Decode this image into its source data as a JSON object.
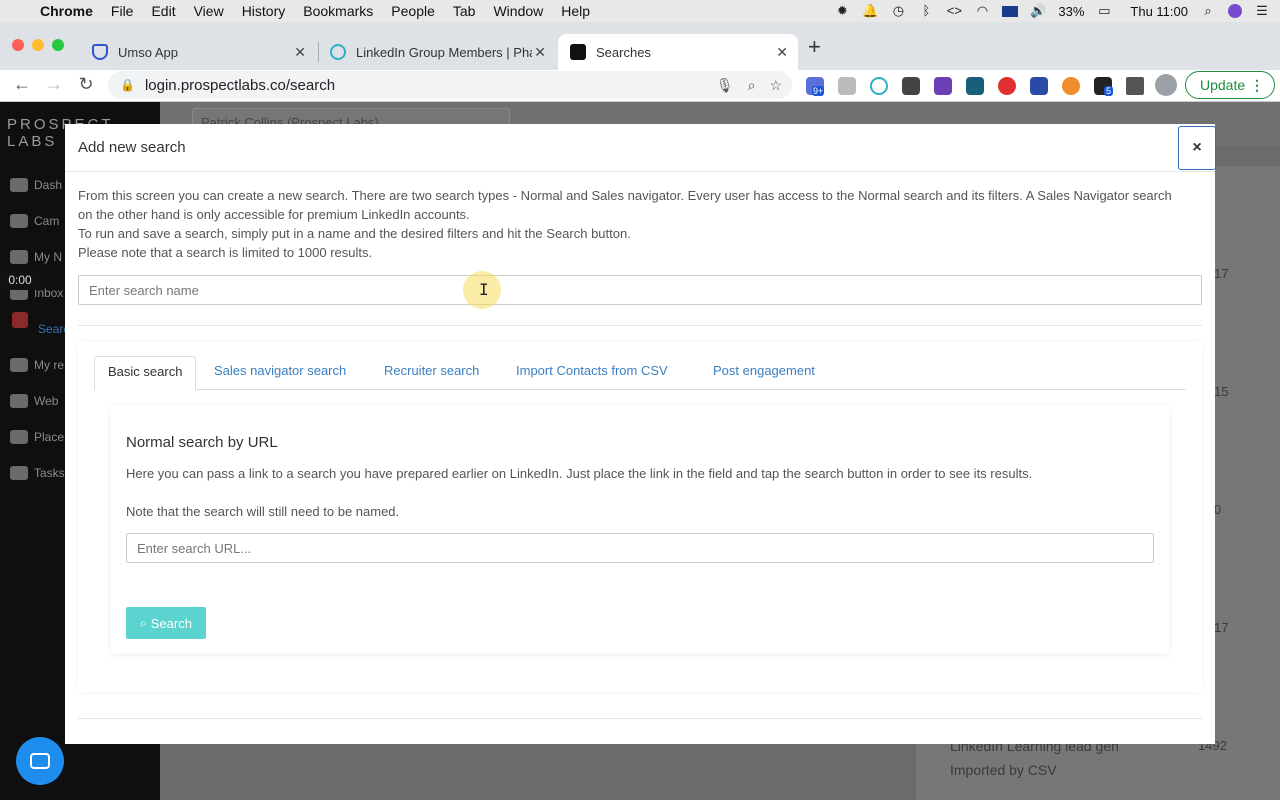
{
  "menubar": {
    "app_name": "Chrome",
    "menus": [
      "File",
      "Edit",
      "View",
      "History",
      "Bookmarks",
      "People",
      "Tab",
      "Window",
      "Help"
    ],
    "battery": "33%",
    "clock": "Thu 11:00"
  },
  "browser": {
    "tabs": [
      {
        "title": "Umso App"
      },
      {
        "title": "LinkedIn Group Members | Pha"
      },
      {
        "title": "Searches"
      }
    ],
    "url": "login.prospectlabs.co/search",
    "update_label": "Update",
    "ext_badges": {
      "badge_a": "9+",
      "badge_b": "5"
    }
  },
  "app": {
    "brand": "PROSPECT LABS",
    "account_selector": "Patrick Collins (Prospect Labs)",
    "timer": "0:00",
    "sidebar_items": [
      "Dash",
      "Cam",
      "My N",
      "Inbox",
      "Searc",
      "My re",
      "Web",
      "Place",
      "Tasks"
    ],
    "bg_numbers": [
      "17",
      "15",
      "0",
      "17",
      "1492"
    ],
    "bg_texts": [
      "LinkedIn Learning lead gen",
      "Imported by CSV"
    ]
  },
  "modal": {
    "title": "Add new search",
    "close_label": "×",
    "intro_lines": [
      "From this screen you can create a new search. There are two search types - Normal and Sales navigator. Every user has access to the Normal search and its filters. A Sales Navigator search on the other hand is only accessible for premium LinkedIn accounts.",
      "To run and save a search, simply put in a name and the desired filters and hit the Search button.",
      "Please note that a search is limited to 1000 results."
    ],
    "name_placeholder": "Enter search name",
    "tabs": [
      "Basic search",
      "Sales navigator search",
      "Recruiter search",
      "Import Contacts from CSV",
      "Post engagement"
    ],
    "active_tab": "Basic search",
    "basic": {
      "title": "Normal search by URL",
      "description": "Here you can pass a link to a search you have prepared earlier on LinkedIn. Just place the link in the field and tap the search button in order to see its results.",
      "note": "Note that the search will still need to be named.",
      "url_placeholder": "Enter search URL...",
      "search_button": "Search"
    }
  },
  "colors": {
    "accent_teal": "#5bd3cf",
    "link_blue": "#3a7fc2",
    "chat_blue": "#1f8ded",
    "update_green": "#1e8e3e"
  }
}
